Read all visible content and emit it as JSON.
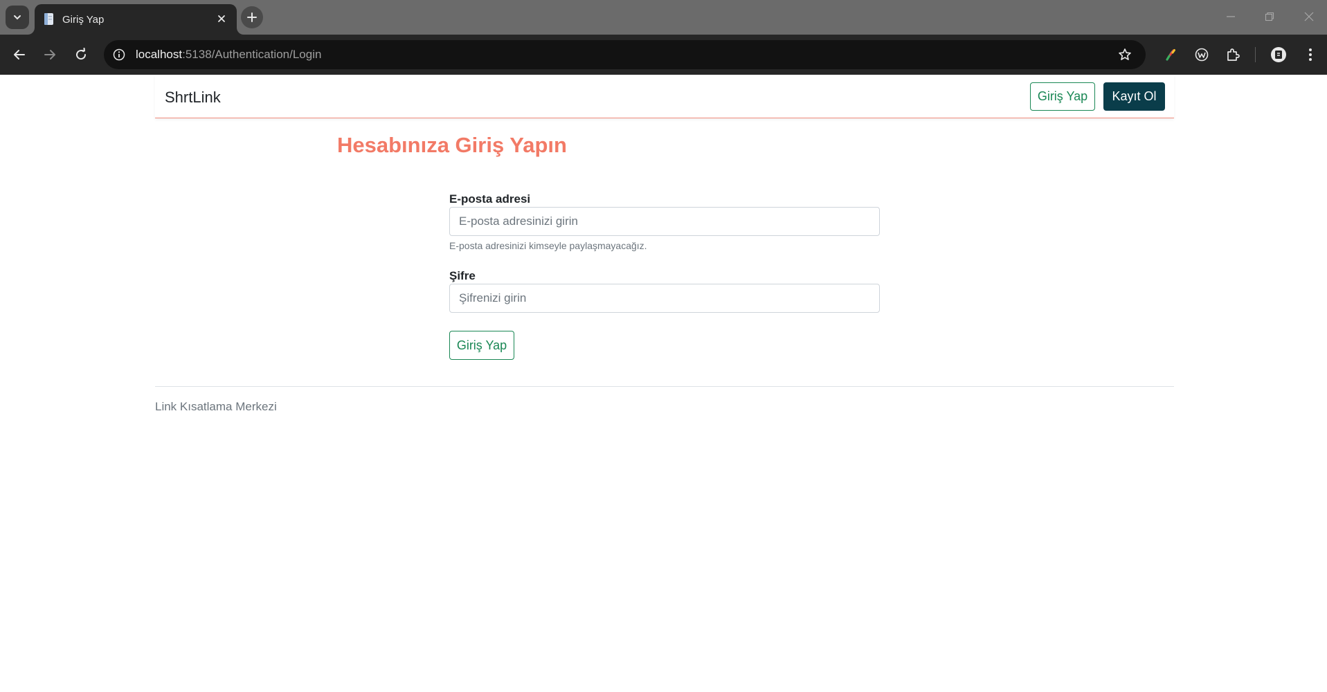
{
  "browser": {
    "tab": {
      "title": "Giriş Yap"
    },
    "address_bar": {
      "host": "localhost",
      "path": ":5138/Authentication/Login"
    }
  },
  "navbar": {
    "brand": "ShrtLink",
    "login_button": "Giriş Yap",
    "register_button": "Kayıt Ol"
  },
  "login_form": {
    "heading": "Hesabınıza Giriş Yapın",
    "email": {
      "label": "E-posta adresi",
      "placeholder": "E-posta adresinizi girin",
      "value": "",
      "help": "E-posta adresinizi kimseyle paylaşmayacağız."
    },
    "password": {
      "label": "Şifre",
      "placeholder": "Şifrenizi girin",
      "value": ""
    },
    "submit": "Giriş Yap"
  },
  "footer": {
    "text": "Link Kısatlama Merkezi"
  },
  "colors": {
    "accent": "#f27a66",
    "success": "#198754",
    "dark_button": "#0a3d4a",
    "navbar_border": "#f08a7a"
  }
}
